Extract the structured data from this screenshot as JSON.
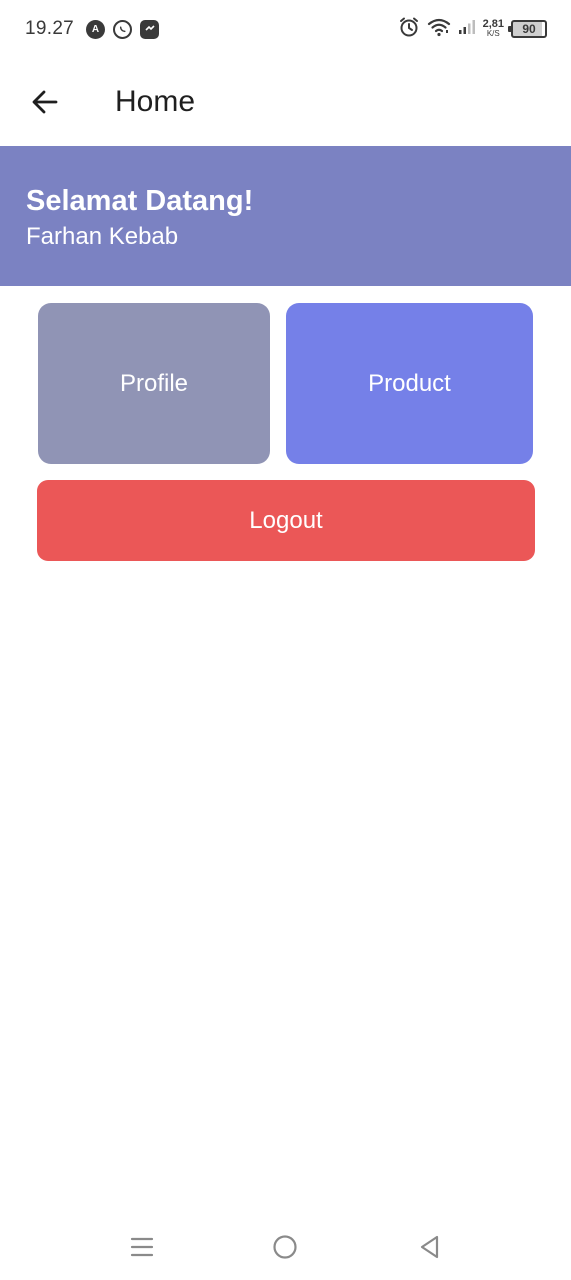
{
  "status_bar": {
    "time": "19.27",
    "notification_icons": [
      "app-a-icon",
      "whatsapp-icon",
      "messenger-icon"
    ],
    "net_speed_value": "2,81",
    "net_speed_unit": "K/S",
    "battery": "90",
    "system_icons": [
      "alarm-icon",
      "wifi-icon",
      "signal-icon"
    ]
  },
  "app_bar": {
    "title": "Home",
    "back_icon": "arrow-left-icon"
  },
  "banner": {
    "greeting": "Selamat Datang!",
    "user_name": "Farhan Kebab",
    "color": "#7b82c2"
  },
  "menu": {
    "profile_label": "Profile",
    "product_label": "Product",
    "logout_label": "Logout",
    "colors": {
      "profile": "#9094b5",
      "product": "#7580e8",
      "logout": "#eb5757"
    }
  },
  "nav_bar": {
    "icons": [
      "recent-apps-icon",
      "home-circle-icon",
      "back-triangle-icon"
    ]
  }
}
